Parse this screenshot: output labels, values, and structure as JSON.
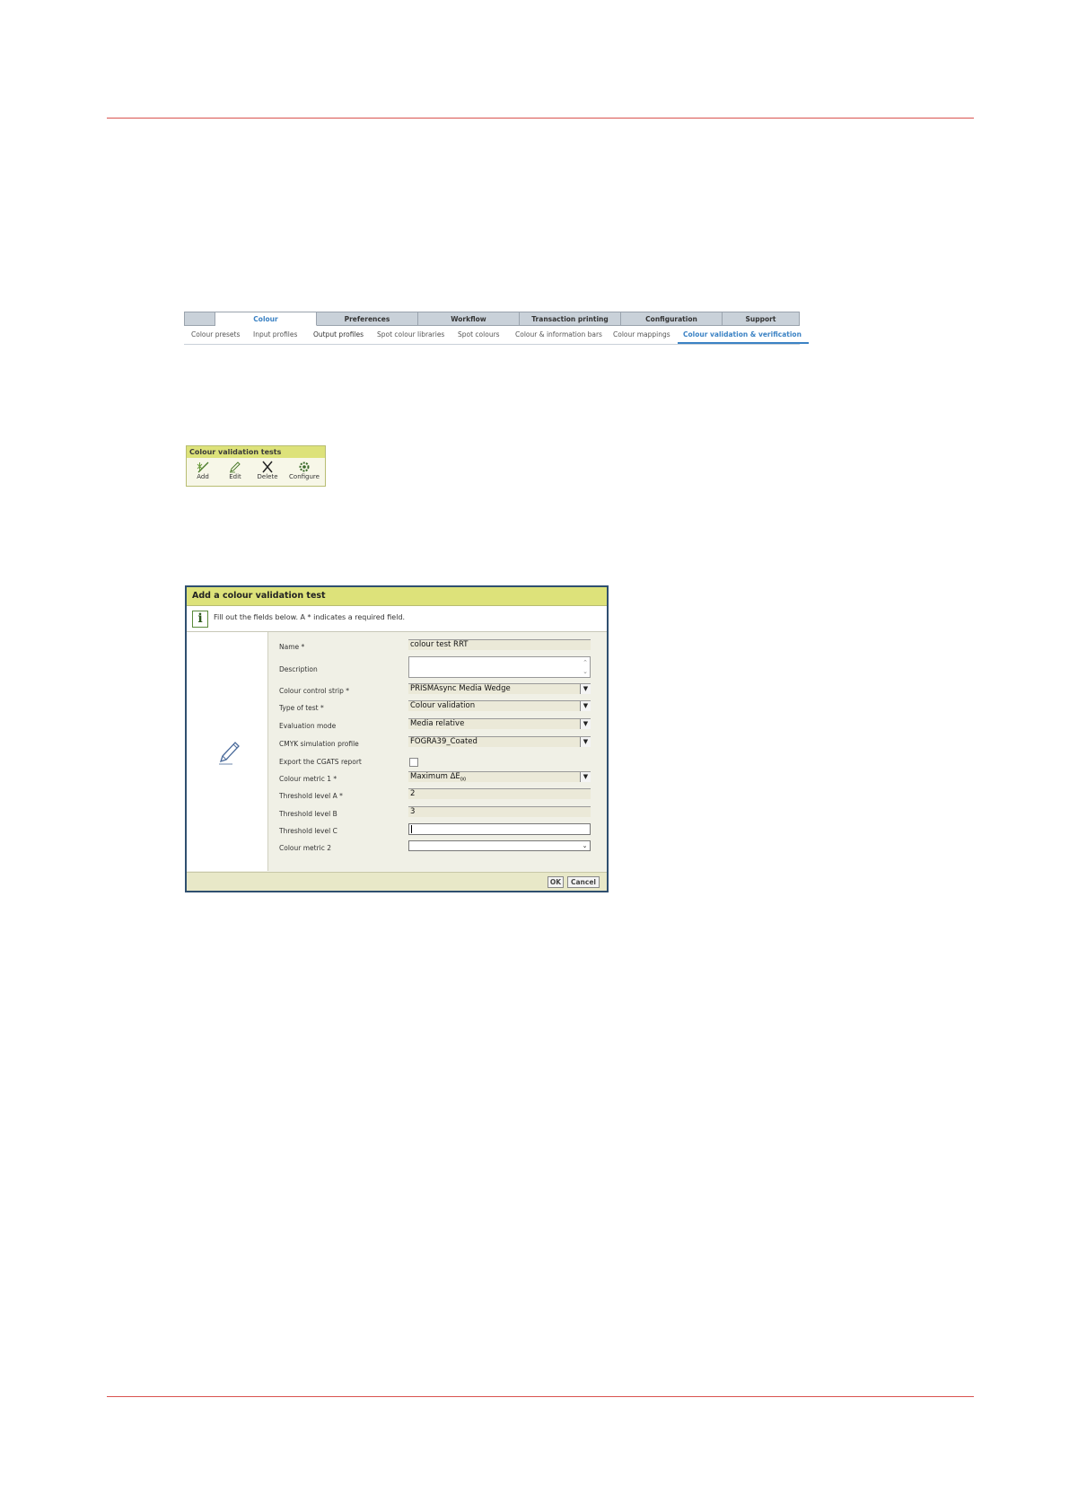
{
  "tabs": {
    "main": [
      "",
      "Colour",
      "Preferences",
      "Workflow",
      "Transaction printing",
      "Configuration",
      "Support"
    ],
    "active_main": "Colour",
    "sub": [
      "Colour presets",
      "Input profiles",
      "Output profiles",
      "Spot colour libraries",
      "Spot colours",
      "Colour & information bars",
      "Colour mappings",
      "Colour validation & verification"
    ],
    "active_sub": "Colour validation & verification"
  },
  "toolbar": {
    "title": "Colour validation tests",
    "buttons": [
      {
        "label": "Add",
        "icon": "add-icon"
      },
      {
        "label": "Edit",
        "icon": "edit-icon"
      },
      {
        "label": "Delete",
        "icon": "delete-icon"
      },
      {
        "label": "Configure",
        "icon": "configure-icon"
      }
    ]
  },
  "dialog": {
    "title": "Add a colour validation test",
    "info": "Fill out the fields below. A * indicates a required field.",
    "fields": {
      "name": {
        "label": "Name *",
        "value": "colour test RRT"
      },
      "description": {
        "label": "Description",
        "value": ""
      },
      "strip": {
        "label": "Colour control strip *",
        "value": "PRISMAsync Media Wedge"
      },
      "type": {
        "label": "Type of test *",
        "value": "Colour validation"
      },
      "mode": {
        "label": "Evaluation mode",
        "value": "Media relative"
      },
      "cmyk": {
        "label": "CMYK simulation profile",
        "value": "FOGRA39_Coated"
      },
      "cgats": {
        "label": "Export the CGATS report",
        "checked": false
      },
      "metric1": {
        "label": "Colour metric 1 *",
        "value_main": "Maximum ΔE",
        "value_sub": "00"
      },
      "thrA": {
        "label": "Threshold level A *",
        "value": "2"
      },
      "thrB": {
        "label": "Threshold level B",
        "value": "3"
      },
      "thrC": {
        "label": "Threshold level C",
        "value": ""
      },
      "metric2": {
        "label": "Colour metric 2",
        "value": ""
      }
    },
    "ok": "OK",
    "cancel": "Cancel"
  }
}
